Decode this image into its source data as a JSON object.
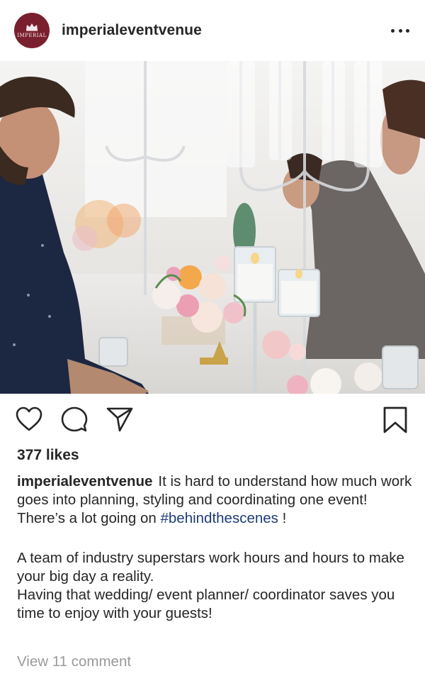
{
  "header": {
    "avatar_text": "IMPERIAL",
    "username": "imperialeventvenue"
  },
  "icons": {
    "more": "more-horizontal-icon",
    "like": "heart-icon",
    "comment": "comment-icon",
    "share": "paper-plane-icon",
    "save": "bookmark-icon"
  },
  "colors": {
    "brand": "#7a1f2e",
    "hashtag": "#1f3c78",
    "muted": "#9a9a9a",
    "text": "#262626"
  },
  "post": {
    "likes": "377 likes",
    "caption": {
      "username": "imperialeventvenue",
      "line1": "It is hard to understand how much work goes into planning, styling and coordinating one event!",
      "line2_prefix": "There’s a lot going on ",
      "hashtag": "#behindthescenes",
      "line2_suffix": " !",
      "line3": "A team of industry superstars work hours and hours to make your big day a reality.",
      "line4": "Having that  wedding/ event planner/ coordinator saves you time to enjoy with your guests!"
    },
    "view_comments": "View 11 comment"
  }
}
